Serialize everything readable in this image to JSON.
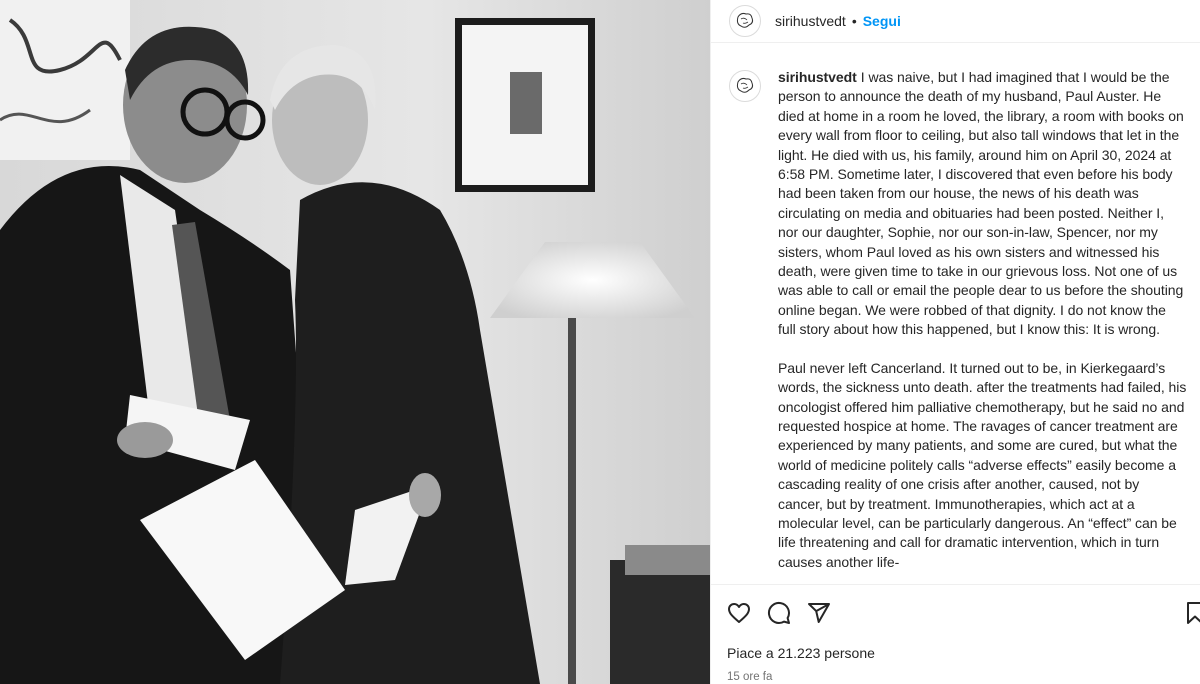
{
  "post": {
    "username": "sirihustvedt",
    "separator": "•",
    "follow_label": "Segui",
    "caption_paragraphs": [
      "I was naive, but I had imagined that I would be the person to announce the death of my husband, Paul Auster. He died at home in a room he loved, the library, a room with books on every wall from floor to ceiling, but also tall windows that let in the light. He died with us, his family, around him on April 30, 2024 at 6:58 PM. Sometime later, I discovered that even before his body had been taken from our house, the news of his death was circulating on media and obituaries had been posted. Neither I, nor our daughter, Sophie, nor our son-in-law, Spencer, nor my sisters, whom Paul loved as his own sisters and witnessed his death, were given time to take in our grievous loss. Not one of us was able to call or email the people dear to us before the shouting online began. We were robbed of that dignity. I do not know the full story about how this happened, but I know this: It is wrong.",
      "Paul never left Cancerland. It turned out to be, in Kierkegaard’s words, the sickness unto death. after the treatments had failed, his oncologist offered him palliative chemotherapy, but he said no and requested hospice at home. The ravages of cancer treatment are experienced by many patients, and some are cured, but what the world of medicine politely calls “adverse effects” easily become a cascading reality of one crisis after another, caused, not by cancer, but by treatment. Immunotherapies, which act at a molecular level, can be particularly dangerous. An “effect” can be life threatening and call for dramatic intervention, which in turn causes another life-"
    ],
    "likes_text": "Piace a 21.223 persone",
    "timestamp": "15 ore fa",
    "icons": {
      "like": "heart-icon",
      "comment": "comment-icon",
      "share": "share-icon",
      "save": "bookmark-icon"
    },
    "colors": {
      "follow": "#0095f6",
      "text": "#262626",
      "muted": "#737373"
    }
  }
}
